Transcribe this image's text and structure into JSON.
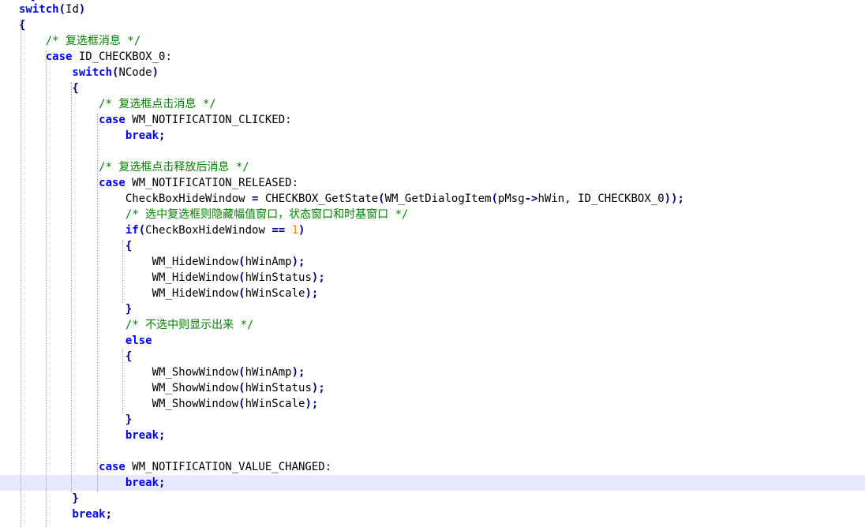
{
  "editor": {
    "colors": {
      "keyword": "#0000ff",
      "comment": "#008000",
      "number": "#ff8000",
      "operator": "#000080",
      "current_line": "#e8e8ff",
      "indent_guide": "#a0a0a0"
    },
    "top_fragment": "  }",
    "lines": [
      {
        "tokens": [
          {
            "t": "kw",
            "v": "switch"
          },
          {
            "t": "br",
            "v": "("
          },
          {
            "t": "id",
            "v": "Id"
          },
          {
            "t": "br",
            "v": ")"
          }
        ]
      },
      {
        "tokens": [
          {
            "t": "br",
            "v": "{"
          }
        ]
      },
      {
        "tokens": [
          {
            "t": "cm",
            "v": "    /* 复选框消息 */"
          }
        ]
      },
      {
        "tokens": [
          {
            "t": "kw",
            "v": "    case"
          },
          {
            "t": "id",
            "v": " ID_CHECKBOX_0:"
          }
        ]
      },
      {
        "tokens": [
          {
            "t": "kw",
            "v": "        switch"
          },
          {
            "t": "br",
            "v": "("
          },
          {
            "t": "id",
            "v": "NCode"
          },
          {
            "t": "br",
            "v": ")"
          }
        ]
      },
      {
        "tokens": [
          {
            "t": "br",
            "v": "        {"
          }
        ]
      },
      {
        "tokens": [
          {
            "t": "cm",
            "v": "            /* 复选框点击消息 */"
          }
        ]
      },
      {
        "tokens": [
          {
            "t": "kw",
            "v": "            case"
          },
          {
            "t": "id",
            "v": " WM_NOTIFICATION_CLICKED:"
          }
        ]
      },
      {
        "tokens": [
          {
            "t": "kw",
            "v": "                break"
          },
          {
            "t": "br",
            "v": ";"
          }
        ]
      },
      {
        "tokens": [
          {
            "t": "id",
            "v": ""
          }
        ]
      },
      {
        "tokens": [
          {
            "t": "cm",
            "v": "            /* 复选框点击释放后消息 */"
          }
        ]
      },
      {
        "tokens": [
          {
            "t": "kw",
            "v": "            case"
          },
          {
            "t": "id",
            "v": " WM_NOTIFICATION_RELEASED:"
          }
        ]
      },
      {
        "tokens": [
          {
            "t": "id",
            "v": "                CheckBoxHideWindow "
          },
          {
            "t": "op",
            "v": "="
          },
          {
            "t": "id",
            "v": " CHECKBOX_GetState"
          },
          {
            "t": "br",
            "v": "("
          },
          {
            "t": "id",
            "v": "WM_GetDialogItem"
          },
          {
            "t": "br",
            "v": "("
          },
          {
            "t": "id",
            "v": "pMsg"
          },
          {
            "t": "op",
            "v": "->"
          },
          {
            "t": "id",
            "v": "hWin, ID_CHECKBOX_0"
          },
          {
            "t": "br",
            "v": "));"
          }
        ]
      },
      {
        "tokens": [
          {
            "t": "cm",
            "v": "                /* 选中复选框则隐藏幅值窗口，状态窗口和时基窗口 */"
          }
        ]
      },
      {
        "tokens": [
          {
            "t": "kw",
            "v": "                if"
          },
          {
            "t": "br",
            "v": "("
          },
          {
            "t": "id",
            "v": "CheckBoxHideWindow "
          },
          {
            "t": "op",
            "v": "=="
          },
          {
            "t": "id",
            "v": " "
          },
          {
            "t": "num",
            "v": "1"
          },
          {
            "t": "br",
            "v": ")"
          }
        ]
      },
      {
        "tokens": [
          {
            "t": "br",
            "v": "                {"
          }
        ]
      },
      {
        "tokens": [
          {
            "t": "id",
            "v": "                    WM_HideWindow"
          },
          {
            "t": "br",
            "v": "("
          },
          {
            "t": "id",
            "v": "hWinAmp"
          },
          {
            "t": "br",
            "v": ");"
          }
        ]
      },
      {
        "tokens": [
          {
            "t": "id",
            "v": "                    WM_HideWindow"
          },
          {
            "t": "br",
            "v": "("
          },
          {
            "t": "id",
            "v": "hWinStatus"
          },
          {
            "t": "br",
            "v": ");"
          }
        ]
      },
      {
        "tokens": [
          {
            "t": "id",
            "v": "                    WM_HideWindow"
          },
          {
            "t": "br",
            "v": "("
          },
          {
            "t": "id",
            "v": "hWinScale"
          },
          {
            "t": "br",
            "v": ");"
          }
        ]
      },
      {
        "tokens": [
          {
            "t": "br",
            "v": "                }"
          }
        ]
      },
      {
        "tokens": [
          {
            "t": "cm",
            "v": "                /* 不选中则显示出来 */"
          }
        ]
      },
      {
        "tokens": [
          {
            "t": "kw",
            "v": "                else"
          }
        ]
      },
      {
        "tokens": [
          {
            "t": "br",
            "v": "                {"
          }
        ]
      },
      {
        "tokens": [
          {
            "t": "id",
            "v": "                    WM_ShowWindow"
          },
          {
            "t": "br",
            "v": "("
          },
          {
            "t": "id",
            "v": "hWinAmp"
          },
          {
            "t": "br",
            "v": ");"
          }
        ]
      },
      {
        "tokens": [
          {
            "t": "id",
            "v": "                    WM_ShowWindow"
          },
          {
            "t": "br",
            "v": "("
          },
          {
            "t": "id",
            "v": "hWinStatus"
          },
          {
            "t": "br",
            "v": ");"
          }
        ]
      },
      {
        "tokens": [
          {
            "t": "id",
            "v": "                    WM_ShowWindow"
          },
          {
            "t": "br",
            "v": "("
          },
          {
            "t": "id",
            "v": "hWinScale"
          },
          {
            "t": "br",
            "v": ");"
          }
        ]
      },
      {
        "tokens": [
          {
            "t": "br",
            "v": "                }"
          }
        ]
      },
      {
        "tokens": [
          {
            "t": "kw",
            "v": "                break"
          },
          {
            "t": "br",
            "v": ";"
          }
        ]
      },
      {
        "tokens": [
          {
            "t": "id",
            "v": ""
          }
        ]
      },
      {
        "tokens": [
          {
            "t": "kw",
            "v": "            case"
          },
          {
            "t": "id",
            "v": " WM_NOTIFICATION_VALUE_CHANGED:"
          }
        ]
      },
      {
        "tokens": [
          {
            "t": "kw",
            "v": "                break"
          },
          {
            "t": "br",
            "v": ";"
          }
        ],
        "current": true
      },
      {
        "tokens": [
          {
            "t": "br",
            "v": "        }"
          }
        ]
      },
      {
        "tokens": [
          {
            "t": "kw",
            "v": "        break"
          },
          {
            "t": "br",
            "v": ";"
          }
        ]
      }
    ]
  }
}
